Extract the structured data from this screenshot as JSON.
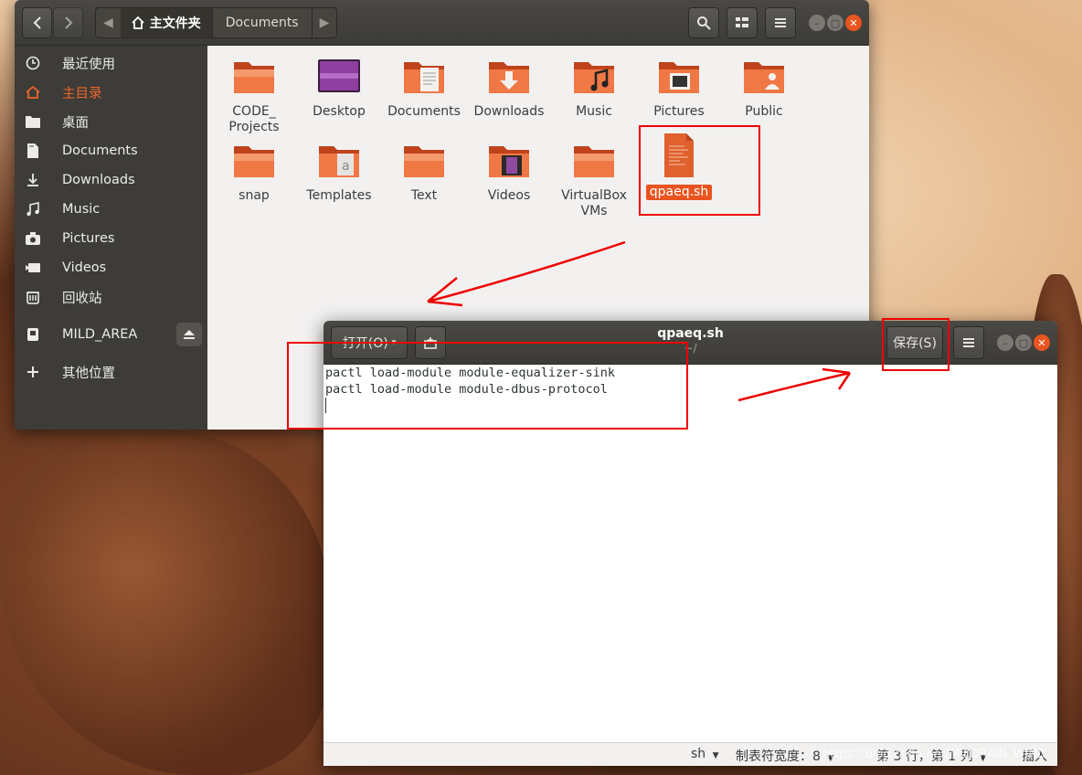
{
  "file_manager": {
    "breadcrumb": {
      "home": "主文件夹",
      "current": "Documents"
    },
    "sidebar": {
      "items": [
        {
          "label": "最近使用",
          "icon": "clock-icon"
        },
        {
          "label": "主目录",
          "icon": "home-icon",
          "active": true
        },
        {
          "label": "桌面",
          "icon": "desktop-folder-icon"
        },
        {
          "label": "Documents",
          "icon": "document-icon"
        },
        {
          "label": "Downloads",
          "icon": "download-icon"
        },
        {
          "label": "Music",
          "icon": "music-icon"
        },
        {
          "label": "Pictures",
          "icon": "camera-icon"
        },
        {
          "label": "Videos",
          "icon": "video-icon"
        },
        {
          "label": "回收站",
          "icon": "trash-icon"
        },
        {
          "label": "MILD_AREA",
          "icon": "drive-icon",
          "eject": true
        },
        {
          "label": "其他位置",
          "icon": "plus-icon"
        }
      ]
    },
    "items": [
      {
        "name": "CODE_\nProjects",
        "type": "folder"
      },
      {
        "name": "Desktop",
        "type": "desktop-folder"
      },
      {
        "name": "Documents",
        "type": "documents-folder"
      },
      {
        "name": "Downloads",
        "type": "downloads-folder"
      },
      {
        "name": "Music",
        "type": "music-folder"
      },
      {
        "name": "Pictures",
        "type": "pictures-folder"
      },
      {
        "name": "Public",
        "type": "public-folder"
      },
      {
        "name": "snap",
        "type": "folder"
      },
      {
        "name": "Templates",
        "type": "templates-folder"
      },
      {
        "name": "Text",
        "type": "folder"
      },
      {
        "name": "Videos",
        "type": "videos-folder"
      },
      {
        "name": "VirtualBox\nVMs",
        "type": "folder"
      },
      {
        "name": "qpaeq.sh",
        "type": "script-file",
        "selected": true
      }
    ]
  },
  "editor": {
    "open_label": "打开(O)",
    "title": "qpaeq.sh",
    "subtitle": "~/",
    "save_label": "保存(S)",
    "lines": [
      "pactl load-module module-equalizer-sink",
      "pactl load-module module-dbus-protocol"
    ],
    "status": {
      "language": "sh",
      "tab_width": "制表符宽度：8",
      "position": "第 3 行，第 1 列",
      "mode": "插入"
    }
  },
  "watermark": "https://blog.csdn.net/MILDRAIN_WIND",
  "colors": {
    "accent": "#e95420",
    "annotation": "#ee0000",
    "header": "#3c3b37"
  }
}
